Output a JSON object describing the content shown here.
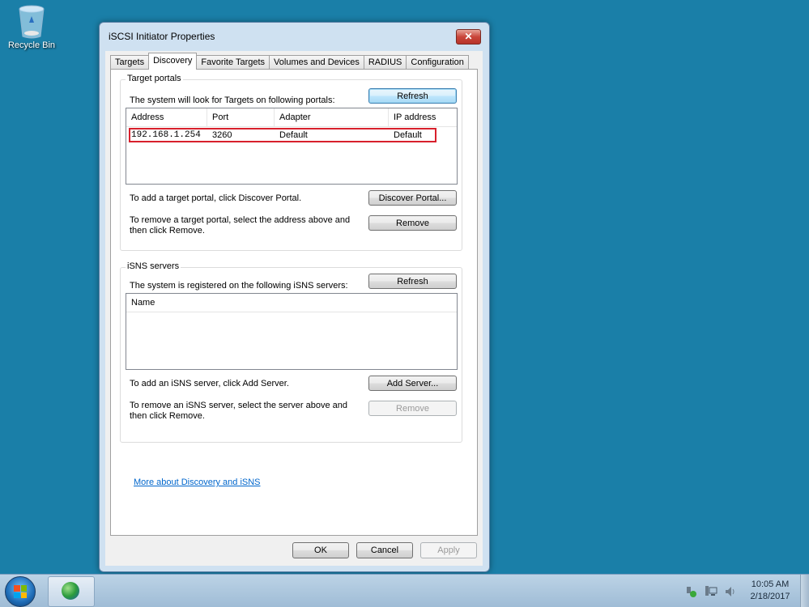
{
  "desktop": {
    "icons": [
      {
        "label": "Recycle Bin",
        "icon": "recycle-bin-icon"
      }
    ]
  },
  "window": {
    "title": "iSCSI Initiator Properties",
    "close_label": "✕",
    "tabs": [
      {
        "label": "Targets",
        "active": false
      },
      {
        "label": "Discovery",
        "active": true
      },
      {
        "label": "Favorite Targets",
        "active": false
      },
      {
        "label": "Volumes and Devices",
        "active": false
      },
      {
        "label": "RADIUS",
        "active": false
      },
      {
        "label": "Configuration",
        "active": false
      }
    ],
    "target_portals": {
      "group_label": "Target portals",
      "description": "The system will look for Targets on following portals:",
      "refresh_label": "Refresh",
      "columns": [
        "Address",
        "Port",
        "Adapter",
        "IP address"
      ],
      "rows": [
        {
          "address": "192.168.1.254",
          "port": "3260",
          "adapter": "Default",
          "ip_address": "Default"
        }
      ],
      "add_text": "To add a target portal, click Discover Portal.",
      "discover_label": "Discover Portal...",
      "remove_text_1": "To remove a target portal, select the address above and",
      "remove_text_2": "then click Remove.",
      "remove_label": "Remove"
    },
    "isns_servers": {
      "group_label": "iSNS servers",
      "description": "The system is registered on the following iSNS servers:",
      "refresh_label": "Refresh",
      "columns": [
        "Name"
      ],
      "add_text": "To add an iSNS server, click Add Server.",
      "add_label": "Add Server...",
      "remove_text_1": "To remove an iSNS server, select the server above and",
      "remove_text_2": "then click Remove.",
      "remove_label": "Remove"
    },
    "link_label": "More about Discovery and iSNS",
    "footer": {
      "ok": "OK",
      "cancel": "Cancel",
      "apply": "Apply"
    }
  },
  "taskbar": {
    "time": "10:05 AM",
    "date": "2/18/2017"
  }
}
